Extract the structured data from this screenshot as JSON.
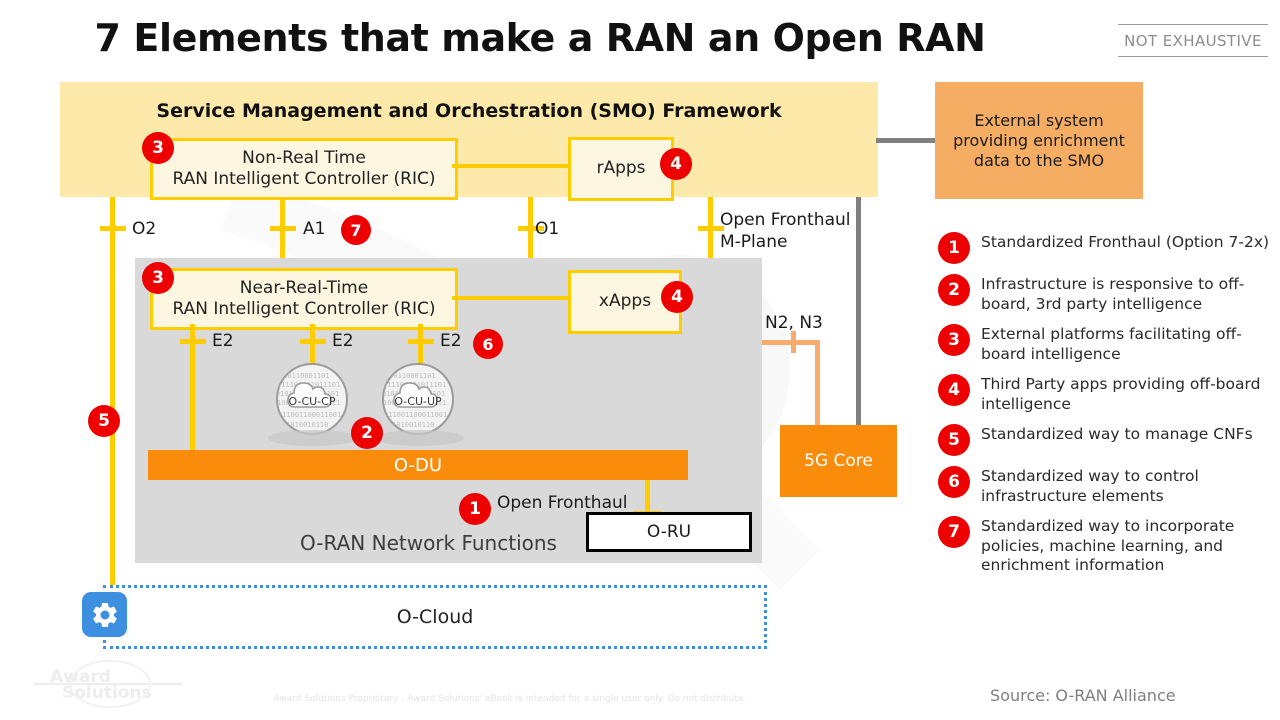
{
  "title": "7 Elements that make a RAN an Open RAN",
  "badge_note": "NOT EXHAUSTIVE",
  "smo": {
    "title": "Service Management and Orchestration (SMO) Framework",
    "non_rt_ric_line1": "Non-Real Time",
    "non_rt_ric_line2": "RAN Intelligent Controller (RIC)",
    "rapps": "rApps",
    "badge_ric": "3",
    "badge_rapps": "4"
  },
  "external": {
    "text": "External system providing enrichment data to the SMO"
  },
  "interfaces": {
    "o2": "O2",
    "a1": "A1",
    "a1_badge": "7",
    "o1": "O1",
    "fronthaul_mplane_l1": "Open Fronthaul",
    "fronthaul_mplane_l2": "M-Plane",
    "e2_a": "E2",
    "e2_b": "E2",
    "e2_c": "E2",
    "e2_badge": "6",
    "n2n3": "N2, N3",
    "open_fronthaul": "Open Fronthaul",
    "open_fronthaul_badge": "1",
    "badge_cnf": "5"
  },
  "oran": {
    "near_rt_ric_line1": "Near-Real-Time",
    "near_rt_ric_line2": "RAN Intelligent Controller (RIC)",
    "xapps": "xApps",
    "badge_ric": "3",
    "badge_xapps": "4",
    "ocu_cp": "O-CU-CP",
    "ocu_up": "O-CU-UP",
    "badge_ocu": "2",
    "odu": "O-DU",
    "oru": "O-RU",
    "label": "O-RAN Network Functions"
  },
  "core5g": "5G Core",
  "ocloud": "O-Cloud",
  "legend": [
    {
      "num": "1",
      "text": "Standardized Fronthaul (Option 7-2x)"
    },
    {
      "num": "2",
      "text": "Infrastructure is responsive to off-board, 3rd party intelligence"
    },
    {
      "num": "3",
      "text": "External platforms facilitating off-board intelligence"
    },
    {
      "num": "4",
      "text": "Third Party apps providing off-board intelligence"
    },
    {
      "num": "5",
      "text": "Standardized way to manage CNFs"
    },
    {
      "num": "6",
      "text": "Standardized way to control infrastructure elements"
    },
    {
      "num": "7",
      "text": "Standardized way to incorporate policies, machine learning, and enrichment information"
    }
  ],
  "source": "Source: O-RAN Alliance",
  "footer": "Award Solutions Proprietary - Award Solutions' eBook is intended for a single user only. Do not distribute.",
  "colors": {
    "smo_bg": "#fde9a9",
    "accent_yellow": "#ffcc00",
    "orange": "#fa8c0c",
    "external_orange": "#f5ad63",
    "badge_red": "#ee0000",
    "grey_panel": "#d9d9d9",
    "cloud_blue": "#3d8fe0"
  }
}
